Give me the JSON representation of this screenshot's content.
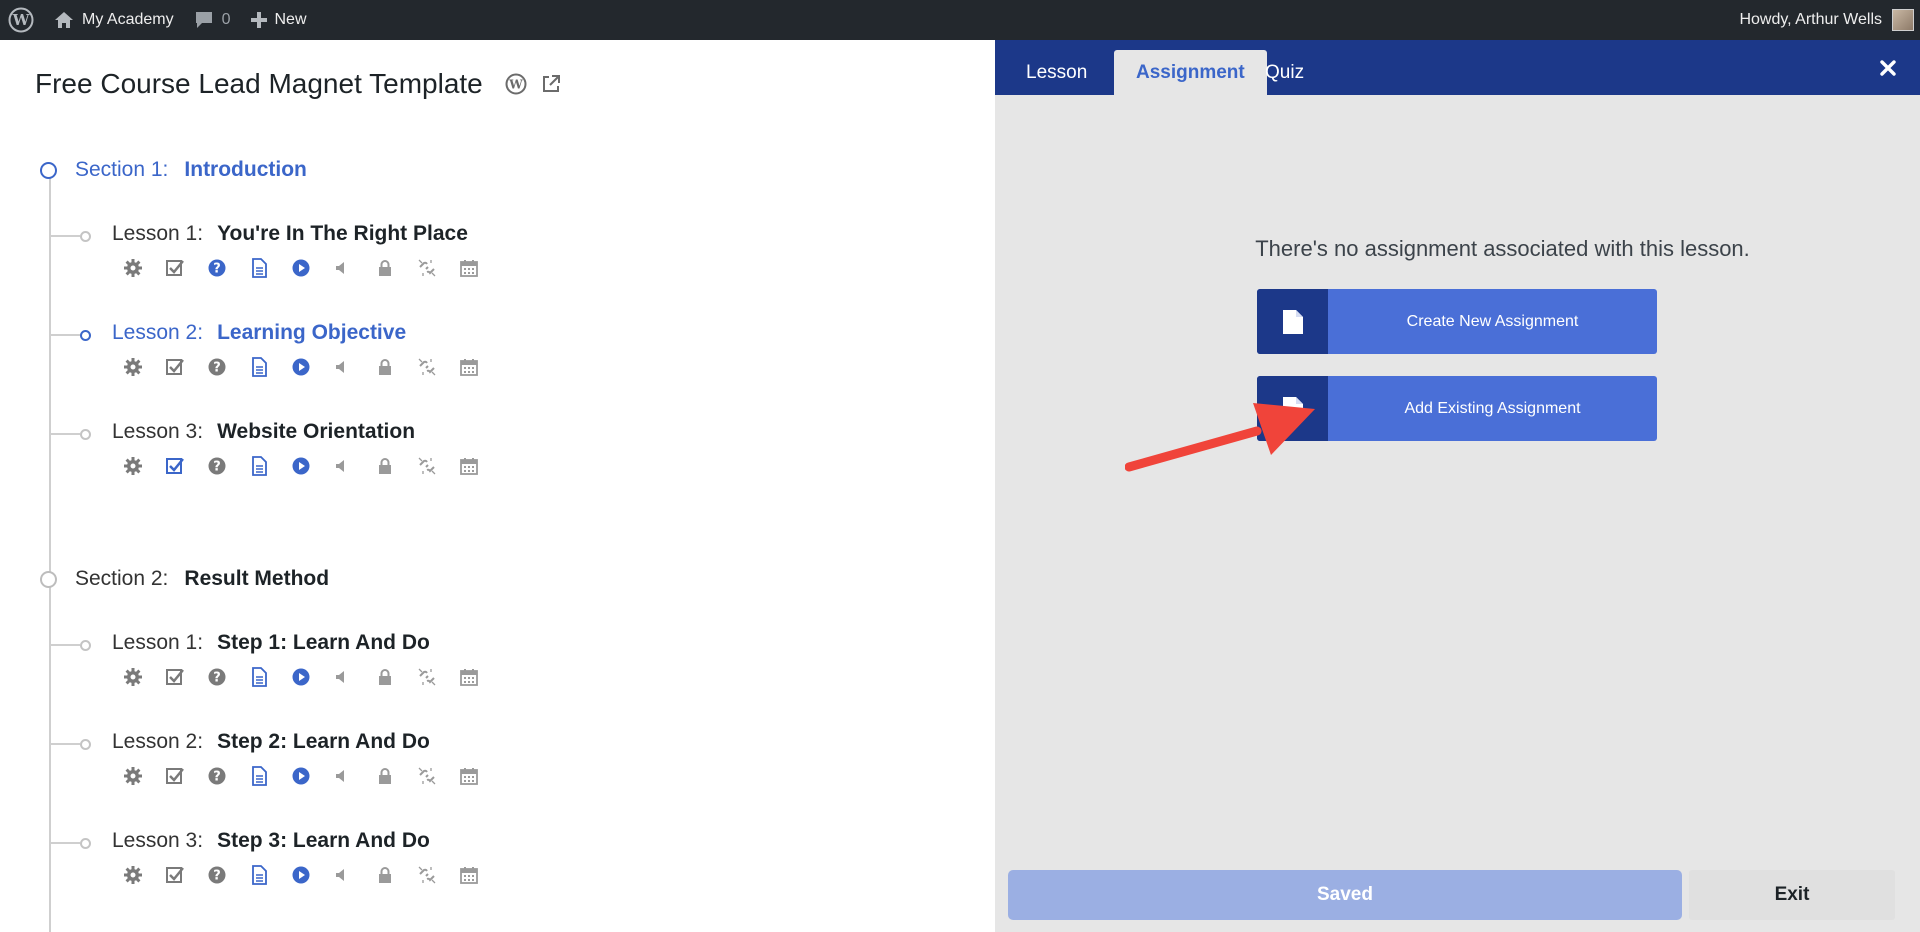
{
  "adminbar": {
    "site_name": "My Academy",
    "comments_count": "0",
    "new_label": "New",
    "greeting": "Howdy, Arthur Wells"
  },
  "course": {
    "title": "Free Course Lead Magnet Template",
    "sections": [
      {
        "label": "Section 1:",
        "name": "Introduction",
        "active": true,
        "lessons": [
          {
            "label": "Lesson 1:",
            "name": "You're In The Right Place",
            "active": false
          },
          {
            "label": "Lesson 2:",
            "name": "Learning Objective",
            "active": true
          },
          {
            "label": "Lesson 3:",
            "name": "Website Orientation",
            "active": false
          }
        ]
      },
      {
        "label": "Section 2:",
        "name": "Result Method",
        "active": false,
        "lessons": [
          {
            "label": "Lesson 1:",
            "name": "Step 1: Learn And Do",
            "active": false
          },
          {
            "label": "Lesson 2:",
            "name": "Step 2: Learn And Do",
            "active": false
          },
          {
            "label": "Lesson 3:",
            "name": "Step 3: Learn And Do",
            "active": false
          }
        ]
      }
    ],
    "lesson_icons": [
      "gear-icon",
      "checkbox-icon",
      "question-icon",
      "document-icon",
      "play-icon",
      "audio-icon",
      "lock-icon",
      "unlink-icon",
      "calendar-icon"
    ]
  },
  "panel": {
    "tabs": [
      "Lesson",
      "Assignment",
      "Quiz"
    ],
    "selected_tab": "Assignment",
    "notice": "There's no assignment associated with this lesson.",
    "create_label": "Create New Assignment",
    "add_label": "Add Existing Assignment",
    "saved_label": "Saved",
    "exit_label": "Exit"
  },
  "colors": {
    "accent": "#3b66c9",
    "navy": "#1c3889",
    "button": "#4a6fd7",
    "arrow": "#f0443a"
  }
}
